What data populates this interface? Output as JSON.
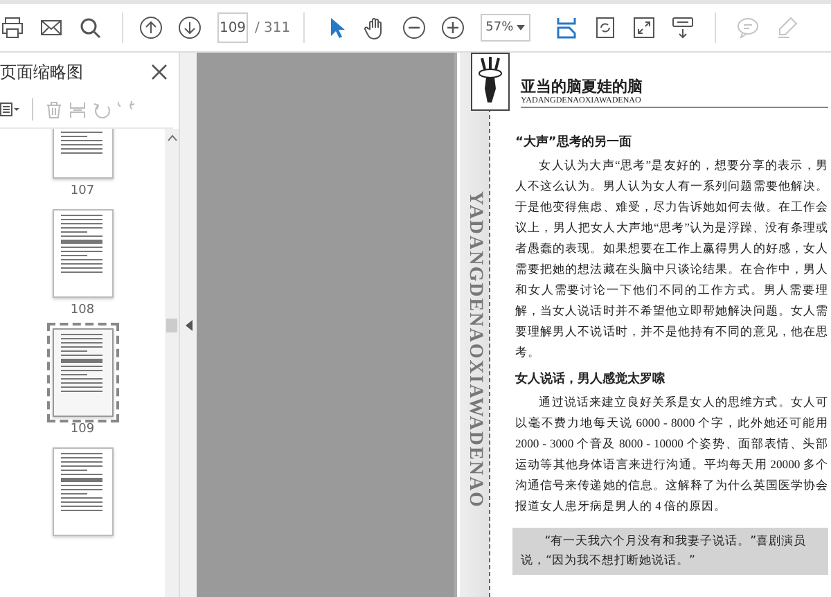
{
  "toolbar": {
    "items": [
      {
        "kind": "tool",
        "active": false,
        "disabled": false
      },
      {
        "kind": "tool",
        "active": false,
        "disabled": false
      },
      {
        "kind": "tool",
        "active": false,
        "disabled": false
      },
      {
        "kind": "separator"
      },
      {
        "kind": "tool",
        "active": false,
        "disabled": false
      },
      {
        "kind": "tool",
        "active": false,
        "disabled": false
      },
      {
        "kind": "page-field",
        "value": "109"
      },
      {
        "kind": "page-total",
        "text": "/ 311"
      },
      {
        "kind": "separator"
      },
      {
        "kind": "tool",
        "active": true,
        "disabled": false
      },
      {
        "kind": "tool",
        "active": false,
        "disabled": false
      },
      {
        "kind": "tool",
        "active": false,
        "disabled": false
      },
      {
        "kind": "tool",
        "active": false,
        "disabled": false
      },
      {
        "kind": "zoom-select",
        "value": "57%"
      },
      {
        "kind": "tool",
        "active": true,
        "disabled": false
      },
      {
        "kind": "tool",
        "active": false,
        "disabled": false
      },
      {
        "kind": "tool",
        "active": false,
        "disabled": false
      },
      {
        "kind": "tool",
        "active": false,
        "disabled": false
      },
      {
        "kind": "separator"
      },
      {
        "kind": "tool",
        "active": false,
        "disabled": true
      },
      {
        "kind": "tool",
        "active": false,
        "disabled": true
      }
    ]
  },
  "sidebar": {
    "title": "页面缩略图",
    "thumbnails": [
      {
        "label": "107",
        "selected": false
      },
      {
        "label": "108",
        "selected": false
      },
      {
        "label": "109",
        "selected": true
      },
      {
        "selected": false
      }
    ]
  },
  "page": {
    "header_title": "亚当的脑夏娃的脑",
    "header_subtitle": "YADANGDENAOXIAWADENAO",
    "side_text": "YADANGDENAOXIAWADENAO",
    "blocks": [
      {
        "kind": "heading",
        "text": "“大声”思考的另一面"
      },
      {
        "kind": "paragraph",
        "text": "女人认为大声“思考”是友好的，想要分享的表示，男人不这么认为。男人认为女人有一系列问题需要他解决。于是他变得焦虑、难受，尽力告诉她如何去做。在工作会议上，男人把女人大声地“思考”认为是浮躁、没有条理或者愚蠢的表现。如果想要在工作上赢得男人的好感，女人需要把她的想法藏在头脑中只谈论结果。在合作中，男人和女人需要讨论一下他们不同的工作方式。男人需要理解，当女人说话时并不希望他立即帮她解决问题。女人需要理解男人不说话时，并不是他持有不同的意见，他在思考。"
      },
      {
        "kind": "heading",
        "text": "女人说话，男人感觉太罗嗦"
      },
      {
        "kind": "paragraph",
        "text": "通过说话来建立良好关系是女人的思维方式。女人可以毫不费力地每天说 6000 - 8000 个字，此外她还可能用 2000 - 3000 个音及 8000 - 10000 个姿势、面部表情、头部运动等其他身体语言来进行沟通。平均每天用 20000 多个沟通信号来传递她的信息。这解释了为什么英国医学协会报道女人患牙病是男人的 4 倍的原因。"
      },
      {
        "kind": "quote",
        "text": "“有一天我六个月没有和我妻子说话。”喜剧演员说，“因为我不想打断她说话。”"
      }
    ]
  }
}
